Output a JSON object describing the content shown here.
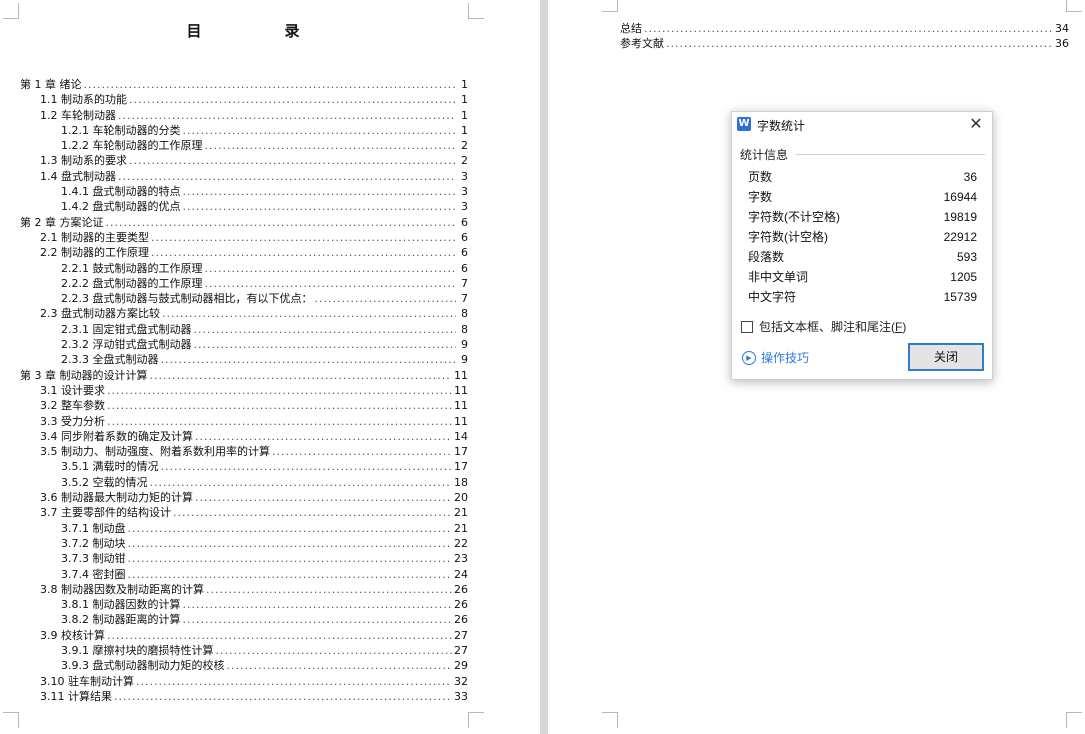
{
  "toc_title": "目　录",
  "left_toc": [
    {
      "text": "第 1 章  绪论",
      "page": "1",
      "level": 1
    },
    {
      "text": "1.1 制动系的功能",
      "page": "1",
      "level": 2
    },
    {
      "text": "1.2 车轮制动器",
      "page": "1",
      "level": 2
    },
    {
      "text": "1.2.1 车轮制动器的分类",
      "page": "1",
      "level": 3
    },
    {
      "text": "1.2.2 车轮制动器的工作原理",
      "page": "2",
      "level": 3
    },
    {
      "text": "1.3 制动系的要求",
      "page": "2",
      "level": 2
    },
    {
      "text": "1.4 盘式制动器",
      "page": "3",
      "level": 2
    },
    {
      "text": "1.4.1 盘式制动器的特点",
      "page": "3",
      "level": 3
    },
    {
      "text": "1.4.2 盘式制动器的优点",
      "page": "3",
      "level": 3
    },
    {
      "text": "第 2 章  方案论证",
      "page": "6",
      "level": 1
    },
    {
      "text": "2.1 制动器的主要类型",
      "page": "6",
      "level": 2
    },
    {
      "text": "2.2 制动器的工作原理",
      "page": "6",
      "level": 2
    },
    {
      "text": "2.2.1 鼓式制动器的工作原理",
      "page": "6",
      "level": 3
    },
    {
      "text": "2.2.2 盘式制动器的工作原理",
      "page": "7",
      "level": 3
    },
    {
      "text": "2.2.3 盘式制动器与鼓式制动器相比，有以下优点：",
      "page": "7",
      "level": 3
    },
    {
      "text": "2.3 盘式制动器方案比较",
      "page": "8",
      "level": 2
    },
    {
      "text": "2.3.1 固定钳式盘式制动器",
      "page": "8",
      "level": 3
    },
    {
      "text": "2.3.2 浮动钳式盘式制动器",
      "page": "9",
      "level": 3
    },
    {
      "text": "2.3.3 全盘式制动器",
      "page": "9",
      "level": 3
    },
    {
      "text": "第 3 章  制动器的设计计算",
      "page": "11",
      "level": 1
    },
    {
      "text": "3.1 设计要求",
      "page": "11",
      "level": 2
    },
    {
      "text": "3.2 整车参数",
      "page": "11",
      "level": 2
    },
    {
      "text": "3.3 受力分析",
      "page": "11",
      "level": 2
    },
    {
      "text": "3.4 同步附着系数的确定及计算",
      "page": "14",
      "level": 2
    },
    {
      "text": "3.5 制动力、制动强度、附着系数利用率的计算",
      "page": "17",
      "level": 2
    },
    {
      "text": "3.5.1 满载时的情况",
      "page": "17",
      "level": 3
    },
    {
      "text": "3.5.2 空载的情况",
      "page": "18",
      "level": 3
    },
    {
      "text": "3.6 制动器最大制动力矩的计算",
      "page": "20",
      "level": 2
    },
    {
      "text": "3.7 主要零部件的结构设计",
      "page": "21",
      "level": 2
    },
    {
      "text": "3.7.1 制动盘",
      "page": "21",
      "level": 3
    },
    {
      "text": "3.7.2 制动块",
      "page": "22",
      "level": 3
    },
    {
      "text": "3.7.3 制动钳",
      "page": "23",
      "level": 3
    },
    {
      "text": "3.7.4 密封圈",
      "page": "24",
      "level": 3
    },
    {
      "text": "3.8 制动器因数及制动距离的计算",
      "page": "26",
      "level": 2
    },
    {
      "text": "3.8.1 制动器因数的计算",
      "page": "26",
      "level": 3
    },
    {
      "text": "3.8.2 制动器距离的计算",
      "page": "26",
      "level": 3
    },
    {
      "text": "3.9  校核计算",
      "page": "27",
      "level": 2
    },
    {
      "text": "3.9.1 摩擦衬块的磨损特性计算",
      "page": "27",
      "level": 3
    },
    {
      "text": "3.9.3 盘式制动器制动力矩的校核",
      "page": "29",
      "level": 3
    },
    {
      "text": "3.10  驻车制动计算",
      "page": "32",
      "level": 2
    },
    {
      "text": "3.11  计算结果",
      "page": "33",
      "level": 2
    }
  ],
  "right_toc": [
    {
      "text": "总结",
      "page": "34",
      "level": 1
    },
    {
      "text": "参考文献",
      "page": "36",
      "level": 1
    }
  ],
  "dialog": {
    "title": "字数统计",
    "close_glyph": "✕",
    "app_icon": "wps-writer-icon",
    "app_icon_letter": "W",
    "group_label": "统计信息",
    "stats": [
      {
        "label": "页数",
        "value": "36"
      },
      {
        "label": "字数",
        "value": "16944"
      },
      {
        "label": "字符数(不计空格)",
        "value": "19819"
      },
      {
        "label": "字符数(计空格)",
        "value": "22912"
      },
      {
        "label": "段落数",
        "value": "593"
      },
      {
        "label": "非中文单词",
        "value": "1205"
      },
      {
        "label": "中文字符",
        "value": "15739"
      }
    ],
    "checkbox_label": "包括文本框、脚注和尾注(",
    "checkbox_hotkey": "F",
    "checkbox_suffix": ")",
    "checkbox_checked": false,
    "tips_label": "操作技巧",
    "close_button_label": "关闭",
    "accent_color": "#2e7bd4"
  }
}
